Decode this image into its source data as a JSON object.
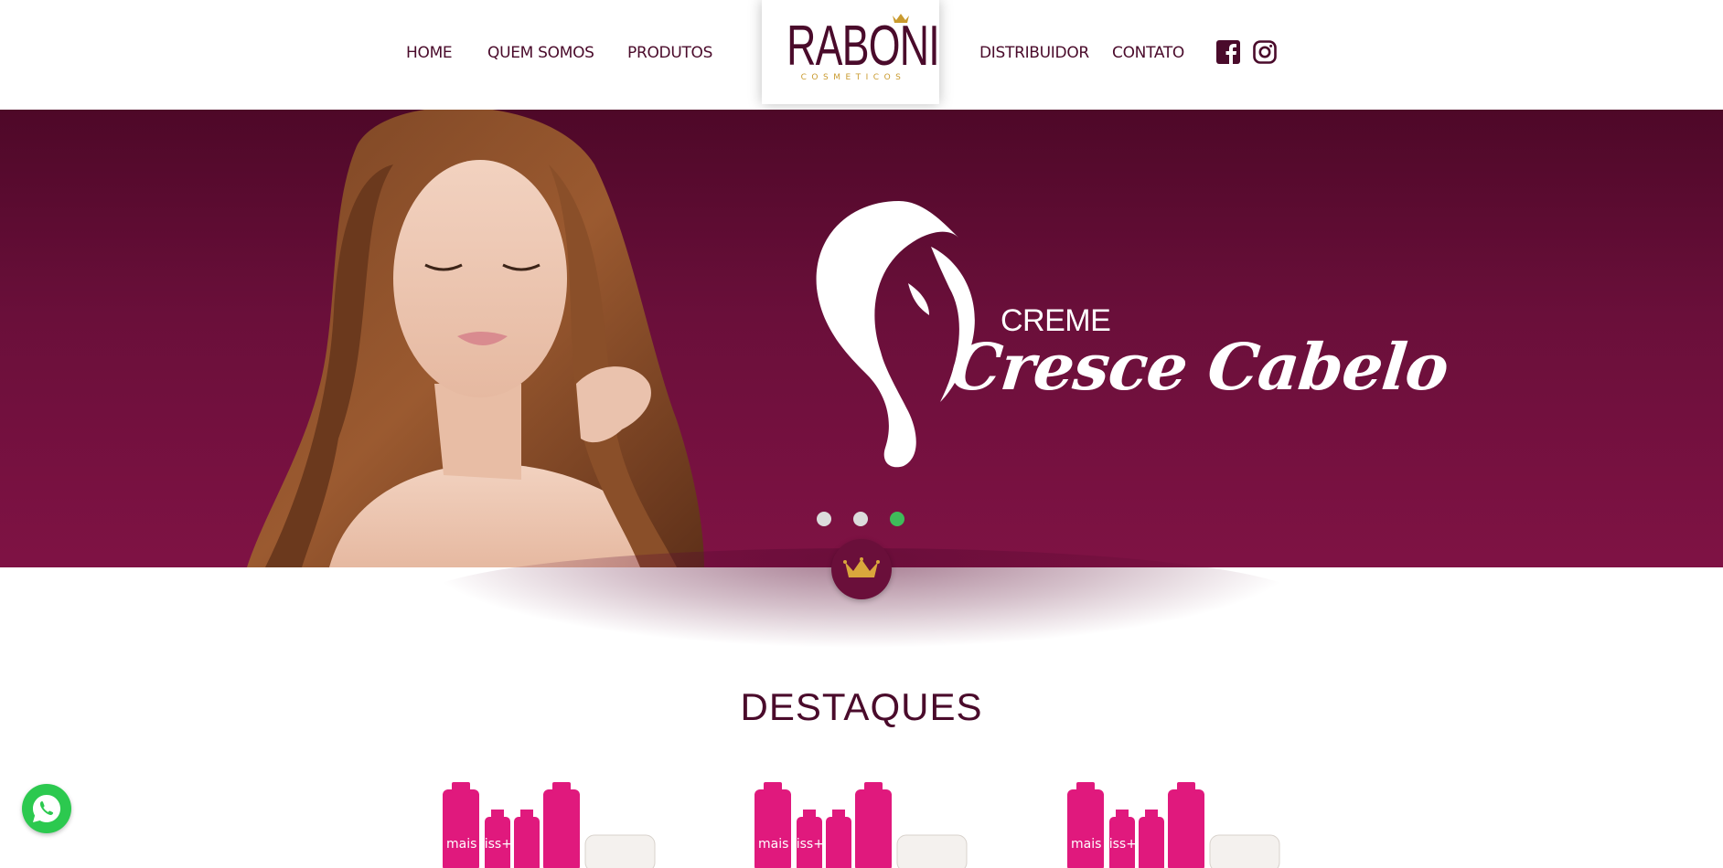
{
  "header": {
    "nav_left": [
      "HOME",
      "QUEM SOMOS",
      "PRODUTOS"
    ],
    "nav_right": [
      "DISTRIBUIDOR",
      "CONTATO"
    ],
    "logo": {
      "name": "RABONI",
      "subtitle": "COSMETICOS"
    },
    "social": [
      "facebook-icon",
      "instagram-icon"
    ]
  },
  "hero": {
    "pre_title": "CREME",
    "title": "Cresce Cabelo",
    "slides": 3,
    "active_slide": 3
  },
  "section": {
    "title": "DESTAQUES"
  },
  "products": [
    {
      "name": "mais liss+"
    },
    {
      "name": "mais liss+"
    },
    {
      "name": "mais liss+"
    }
  ],
  "colors": {
    "brand": "#4a0b2b",
    "hero_top": "#4e0828",
    "hero_bottom": "#7f1244",
    "gold": "#c99a2e",
    "product_pink": "#e0197d",
    "whatsapp": "#2cc94f",
    "slider_active": "#3fbb5a"
  }
}
